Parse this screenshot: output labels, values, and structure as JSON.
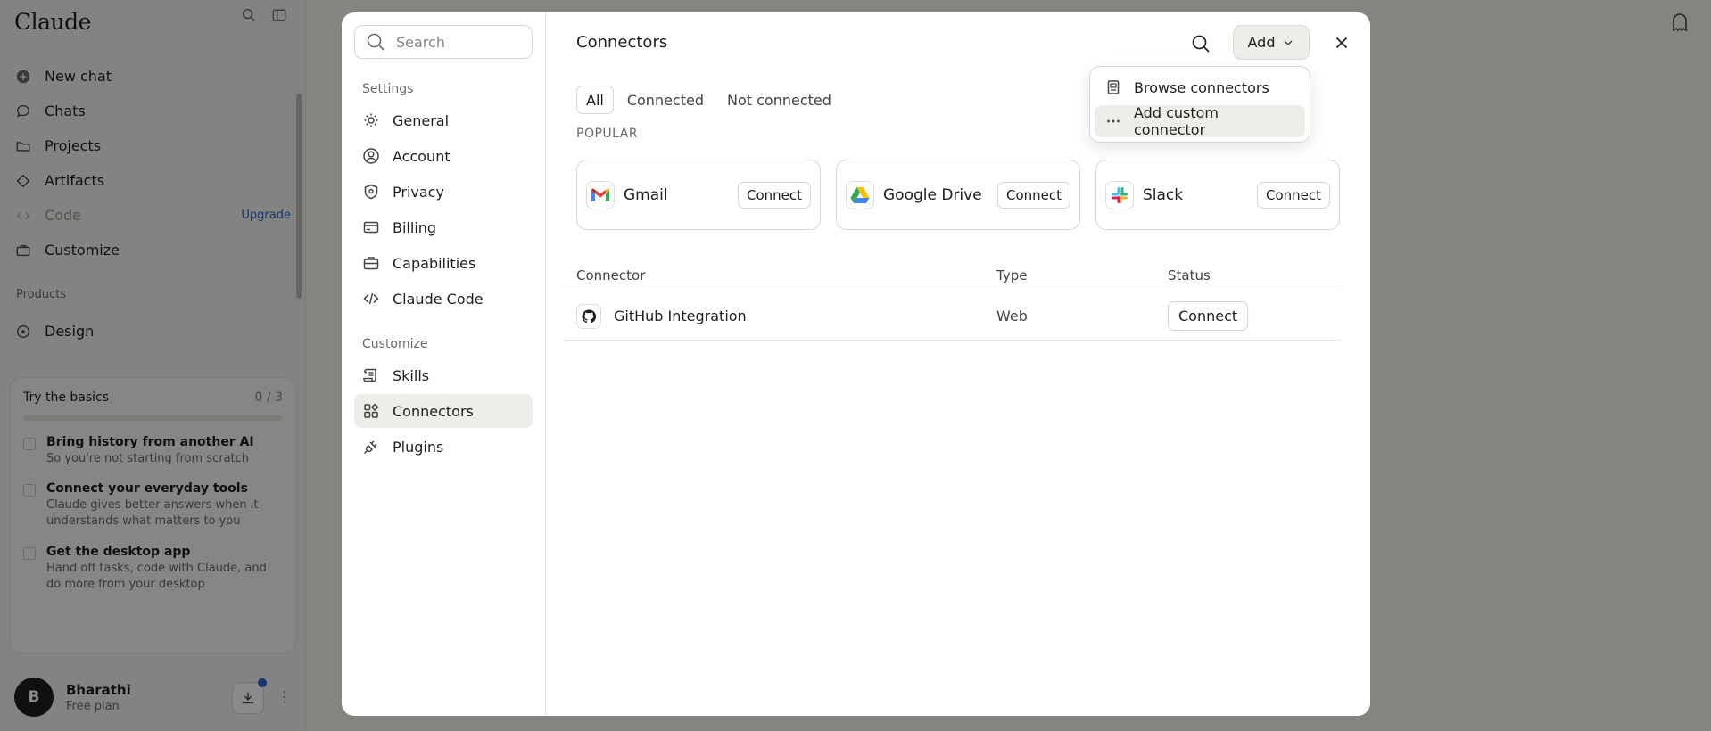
{
  "app": {
    "logo": "Claude",
    "nav": [
      {
        "label": "New chat",
        "icon": "plus-circle-icon"
      },
      {
        "label": "Chats",
        "icon": "chat-bubble-icon"
      },
      {
        "label": "Projects",
        "icon": "folder-icon"
      },
      {
        "label": "Artifacts",
        "icon": "artifacts-icon"
      },
      {
        "label": "Code",
        "icon": "code-icon",
        "badge": "Upgrade"
      },
      {
        "label": "Customize",
        "icon": "briefcase-icon"
      }
    ],
    "products_label": "Products",
    "design_label": "Design",
    "basics": {
      "title": "Try the basics",
      "count": "0 / 3",
      "items": [
        {
          "title": "Bring history from another AI",
          "sub": "So you're not starting from scratch"
        },
        {
          "title": "Connect your everyday tools",
          "sub": "Claude gives better answers when it understands what matters to you"
        },
        {
          "title": "Get the desktop app",
          "sub": "Hand off tasks, code with Claude, and do more from your desktop"
        }
      ]
    },
    "user": {
      "initial": "B",
      "name": "Bharathi",
      "plan": "Free plan"
    }
  },
  "modal": {
    "search_placeholder": "Search",
    "settings_section": "Settings",
    "settings_items": [
      "General",
      "Account",
      "Privacy",
      "Billing",
      "Capabilities",
      "Claude Code"
    ],
    "customize_section": "Customize",
    "customize_items": [
      "Skills",
      "Connectors",
      "Plugins"
    ],
    "active_item": "Connectors",
    "title": "Connectors",
    "add_label": "Add",
    "tabs": [
      "All",
      "Connected",
      "Not connected"
    ],
    "active_tab": "All",
    "popular_label": "POPULAR",
    "popular": [
      {
        "name": "Gmail",
        "icon": "gmail-icon",
        "action": "Connect"
      },
      {
        "name": "Google Drive",
        "icon": "google-drive-icon",
        "action": "Connect"
      },
      {
        "name": "Slack",
        "icon": "slack-icon",
        "action": "Connect"
      }
    ],
    "table": {
      "headers": [
        "Connector",
        "Type",
        "Status"
      ],
      "rows": [
        {
          "name": "GitHub Integration",
          "icon": "github-icon",
          "type": "Web",
          "action": "Connect"
        }
      ]
    },
    "dropdown": [
      {
        "label": "Browse connectors",
        "icon": "book-icon"
      },
      {
        "label": "Add custom connector",
        "icon": "more-horizontal-icon"
      }
    ]
  },
  "colors": {
    "overlay": "#000000",
    "accent_link": "#2c63c6",
    "active_bg": "#efedea"
  }
}
